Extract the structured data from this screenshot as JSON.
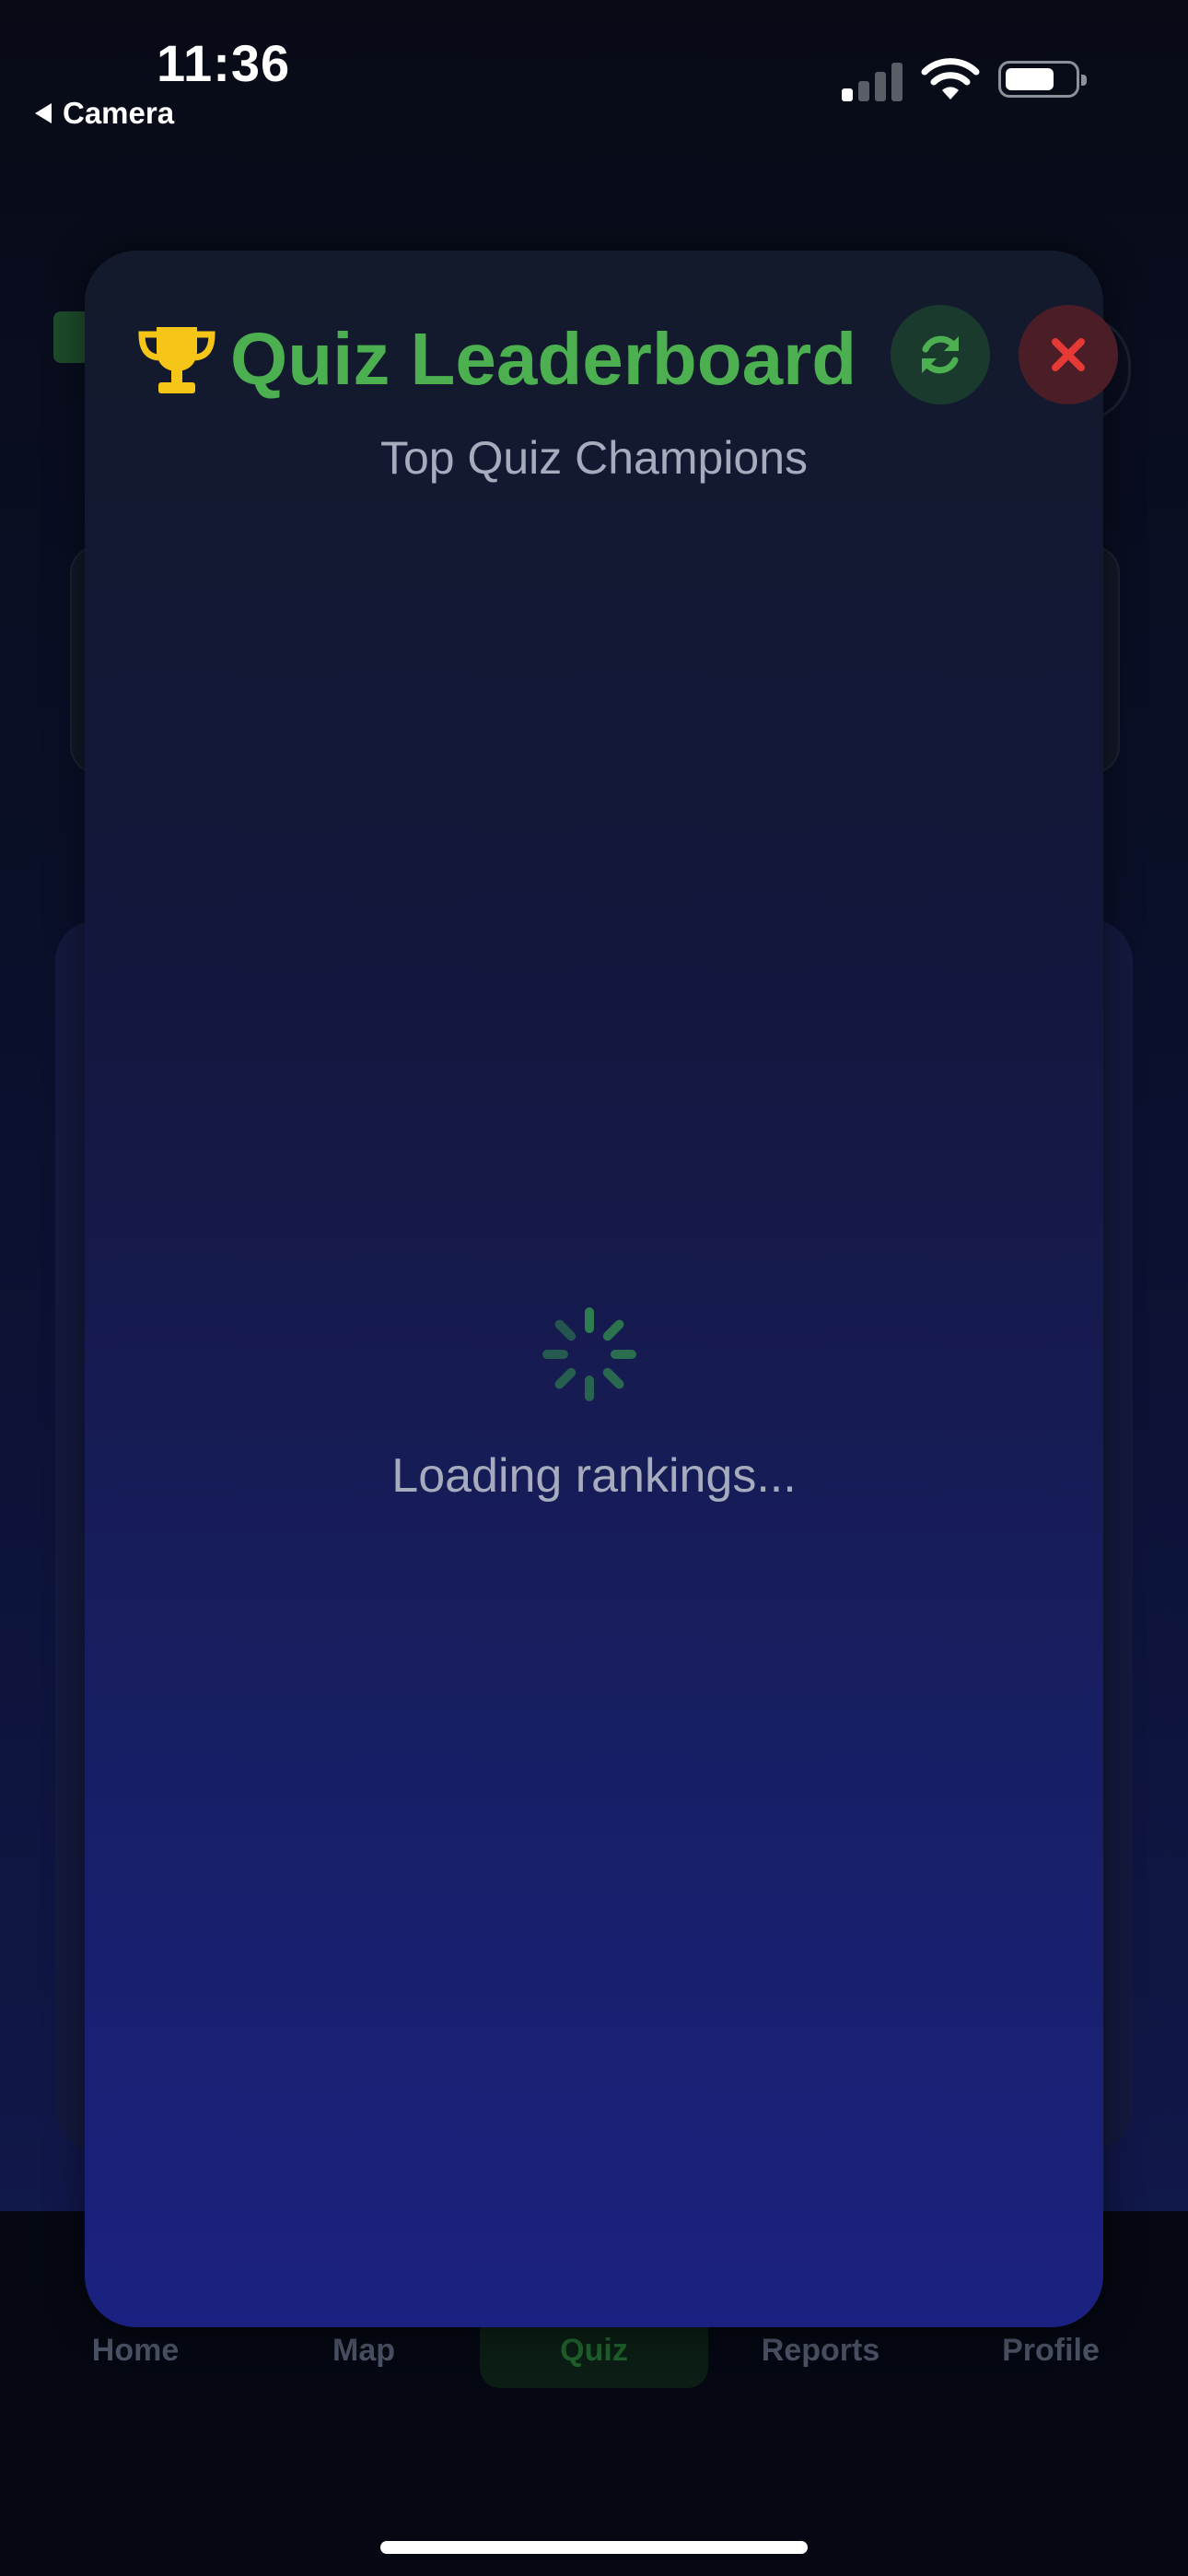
{
  "status_bar": {
    "time": "11:36",
    "back_label": "Camera"
  },
  "modal": {
    "title": "Quiz Leaderboard",
    "subtitle": "Top Quiz Champions",
    "loading_text": "Loading rankings...",
    "icons": {
      "trophy": "trophy-icon",
      "refresh": "refresh-icon",
      "close": "close-icon"
    },
    "colors": {
      "title": "#4caf50",
      "trophy": "#f5c518",
      "close": "#e53935",
      "refresh": "#4caf50"
    }
  },
  "tab_bar": {
    "tabs": [
      {
        "label": "Home"
      },
      {
        "label": "Map"
      },
      {
        "label": "Quiz",
        "active": true
      },
      {
        "label": "Reports"
      },
      {
        "label": "Profile"
      }
    ]
  }
}
